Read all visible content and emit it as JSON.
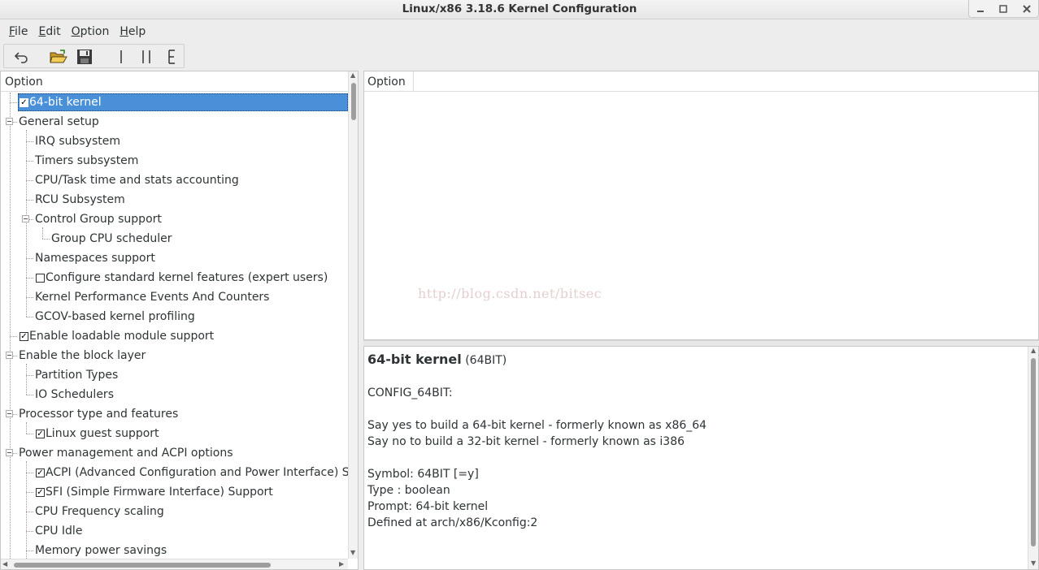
{
  "window": {
    "title": "Linux/x86 3.18.6 Kernel Configuration"
  },
  "menu": {
    "file": {
      "first": "F",
      "rest": "ile"
    },
    "edit": {
      "first": "E",
      "rest": "dit"
    },
    "option": {
      "first": "O",
      "rest": "ption"
    },
    "help": {
      "first": "H",
      "rest": "elp"
    }
  },
  "toolbar": {
    "buttons": [
      "back-icon",
      "open-folder-icon",
      "save-icon",
      "single-view-icon",
      "split-view-icon",
      "full-view-icon"
    ]
  },
  "left_tree": {
    "header": "Option",
    "rows": [
      {
        "label": "64-bit kernel",
        "checkbox": "checked",
        "selected": true
      },
      {
        "label": "General setup",
        "expander": true
      },
      {
        "label": "IRQ subsystem"
      },
      {
        "label": "Timers subsystem"
      },
      {
        "label": "CPU/Task time and stats accounting"
      },
      {
        "label": "RCU Subsystem"
      },
      {
        "label": "Control Group support",
        "expander": true
      },
      {
        "label": "Group CPU scheduler"
      },
      {
        "label": "Namespaces support"
      },
      {
        "label": "Configure standard kernel features (expert users)",
        "checkbox": "unchecked"
      },
      {
        "label": "Kernel Performance Events And Counters"
      },
      {
        "label": "GCOV-based kernel profiling"
      },
      {
        "label": "Enable loadable module support",
        "checkbox": "checked"
      },
      {
        "label": "Enable the block layer",
        "expander": true
      },
      {
        "label": "Partition Types"
      },
      {
        "label": "IO Schedulers"
      },
      {
        "label": "Processor type and features",
        "expander": true
      },
      {
        "label": "Linux guest support",
        "checkbox": "checked"
      },
      {
        "label": "Power management and ACPI options",
        "expander": true
      },
      {
        "label": "ACPI (Advanced Configuration and Power Interface) Support",
        "checkbox": "checked"
      },
      {
        "label": "SFI (Simple Firmware Interface) Support",
        "checkbox": "checked"
      },
      {
        "label": "CPU Frequency scaling"
      },
      {
        "label": "CPU Idle"
      },
      {
        "label": "Memory power savings"
      }
    ]
  },
  "right_options": {
    "header": "Option",
    "watermark": "http://blog.csdn.net/bitsec"
  },
  "help": {
    "title": "64-bit kernel",
    "symbol_paren": "(64BIT)",
    "config": "CONFIG_64BIT:",
    "line_yes": "Say yes to build a 64-bit kernel - formerly known as x86_64",
    "line_no": "Say no to build a 32-bit kernel - formerly known as i386",
    "symbol": "Symbol: 64BIT [=y]",
    "type": "Type : boolean",
    "prompt": "Prompt: 64-bit kernel",
    "defined": "Defined at arch/x86/Kconfig:2"
  }
}
